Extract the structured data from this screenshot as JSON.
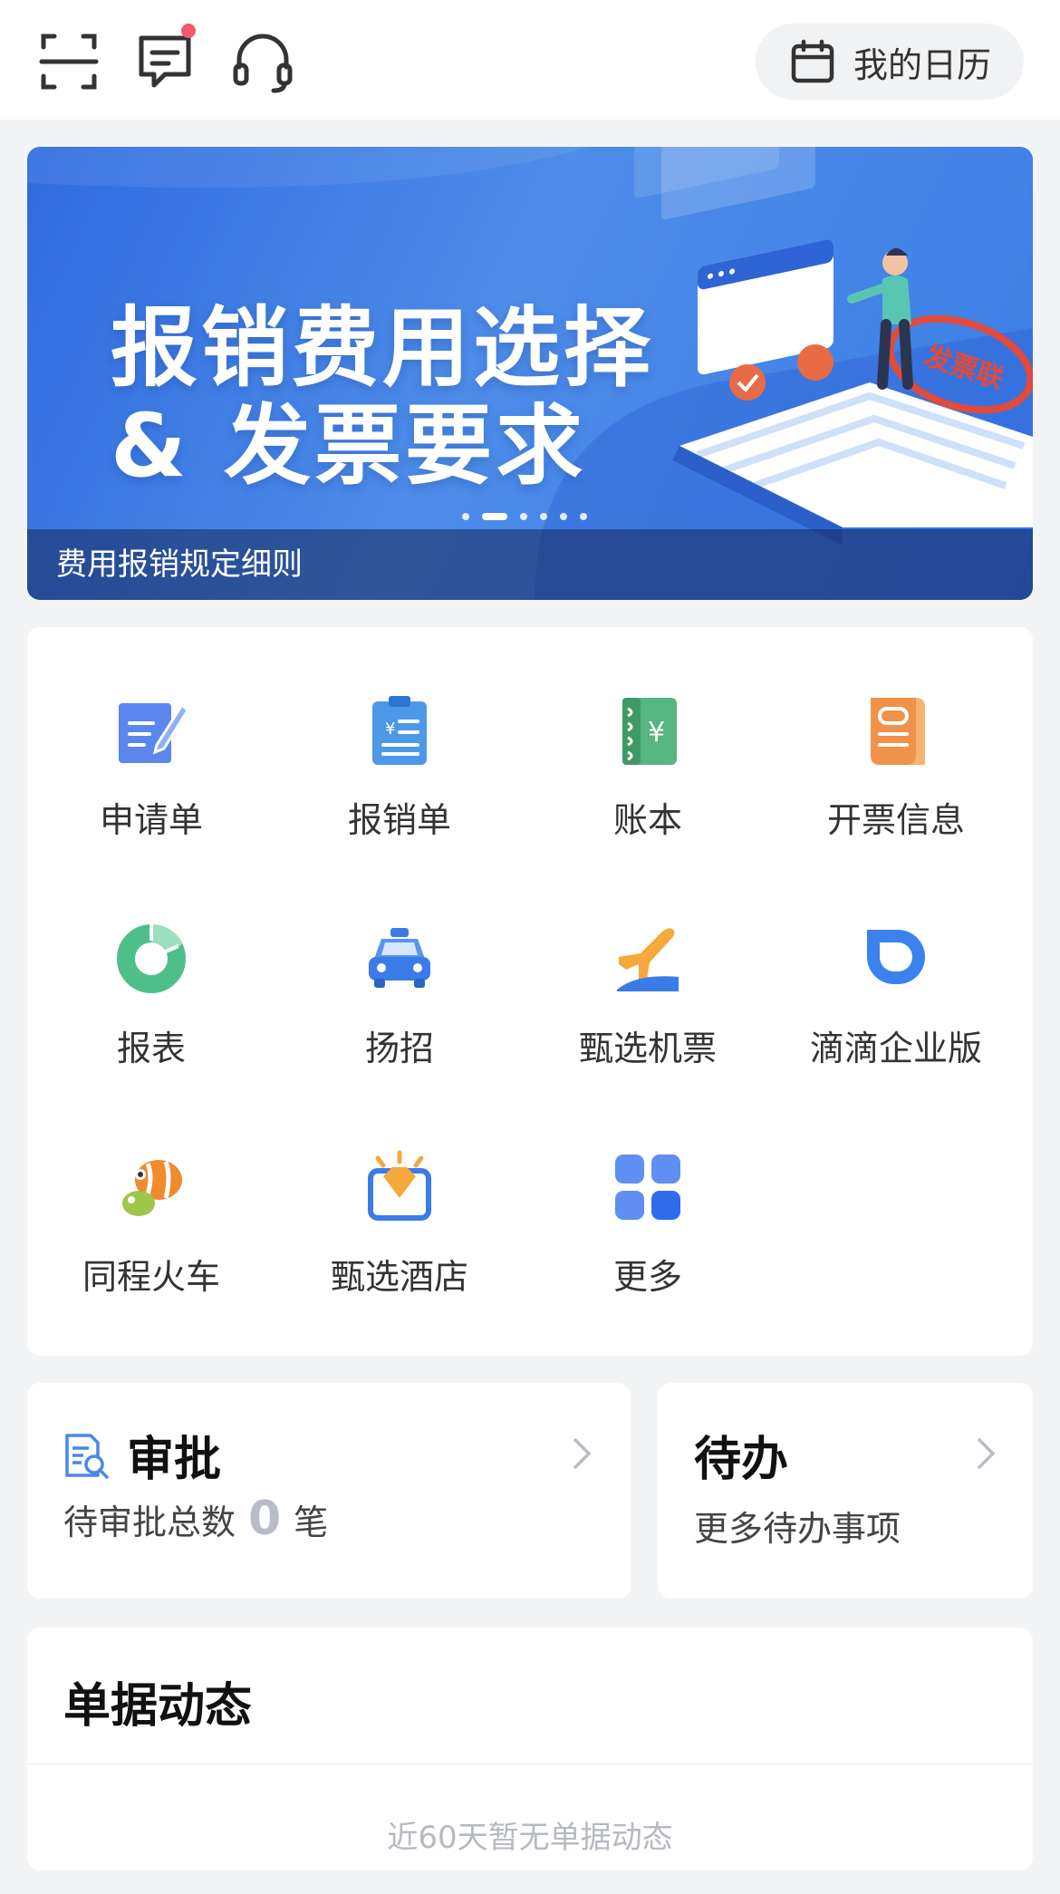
{
  "header": {
    "icons": [
      "scan-icon",
      "message-icon",
      "headset-icon"
    ],
    "calendar_label": "我的日历"
  },
  "banner": {
    "title_line1": "报销费用选择",
    "title_line2": "& 发票要求",
    "caption": "费用报销规定细则",
    "stamp_text": "发票联",
    "slide_count": 6,
    "active_slide": 2
  },
  "grid": {
    "items": [
      {
        "label": "申请单",
        "icon": "application-form-icon"
      },
      {
        "label": "报销单",
        "icon": "reimbursement-form-icon"
      },
      {
        "label": "账本",
        "icon": "ledger-icon"
      },
      {
        "label": "开票信息",
        "icon": "invoice-info-icon"
      },
      {
        "label": "报表",
        "icon": "report-icon"
      },
      {
        "label": "扬招",
        "icon": "taxi-icon"
      },
      {
        "label": "甄选机票",
        "icon": "flight-icon"
      },
      {
        "label": "滴滴企业版",
        "icon": "didi-icon"
      },
      {
        "label": "同程火车",
        "icon": "train-fish-icon"
      },
      {
        "label": "甄选酒店",
        "icon": "hotel-icon"
      },
      {
        "label": "更多",
        "icon": "more-grid-icon"
      }
    ]
  },
  "approve": {
    "title": "审批",
    "sub_prefix": "待审批总数",
    "count": "0",
    "sub_suffix": "笔"
  },
  "todo": {
    "title": "待办",
    "sub": "更多待办事项"
  },
  "documents": {
    "title": "单据动态",
    "empty_text": "近60天暂无单据动态"
  },
  "colors": {
    "accent_blue": "#3b7de6",
    "page_bg": "#f3f4f6",
    "notification_dot": "#f25a6a"
  }
}
